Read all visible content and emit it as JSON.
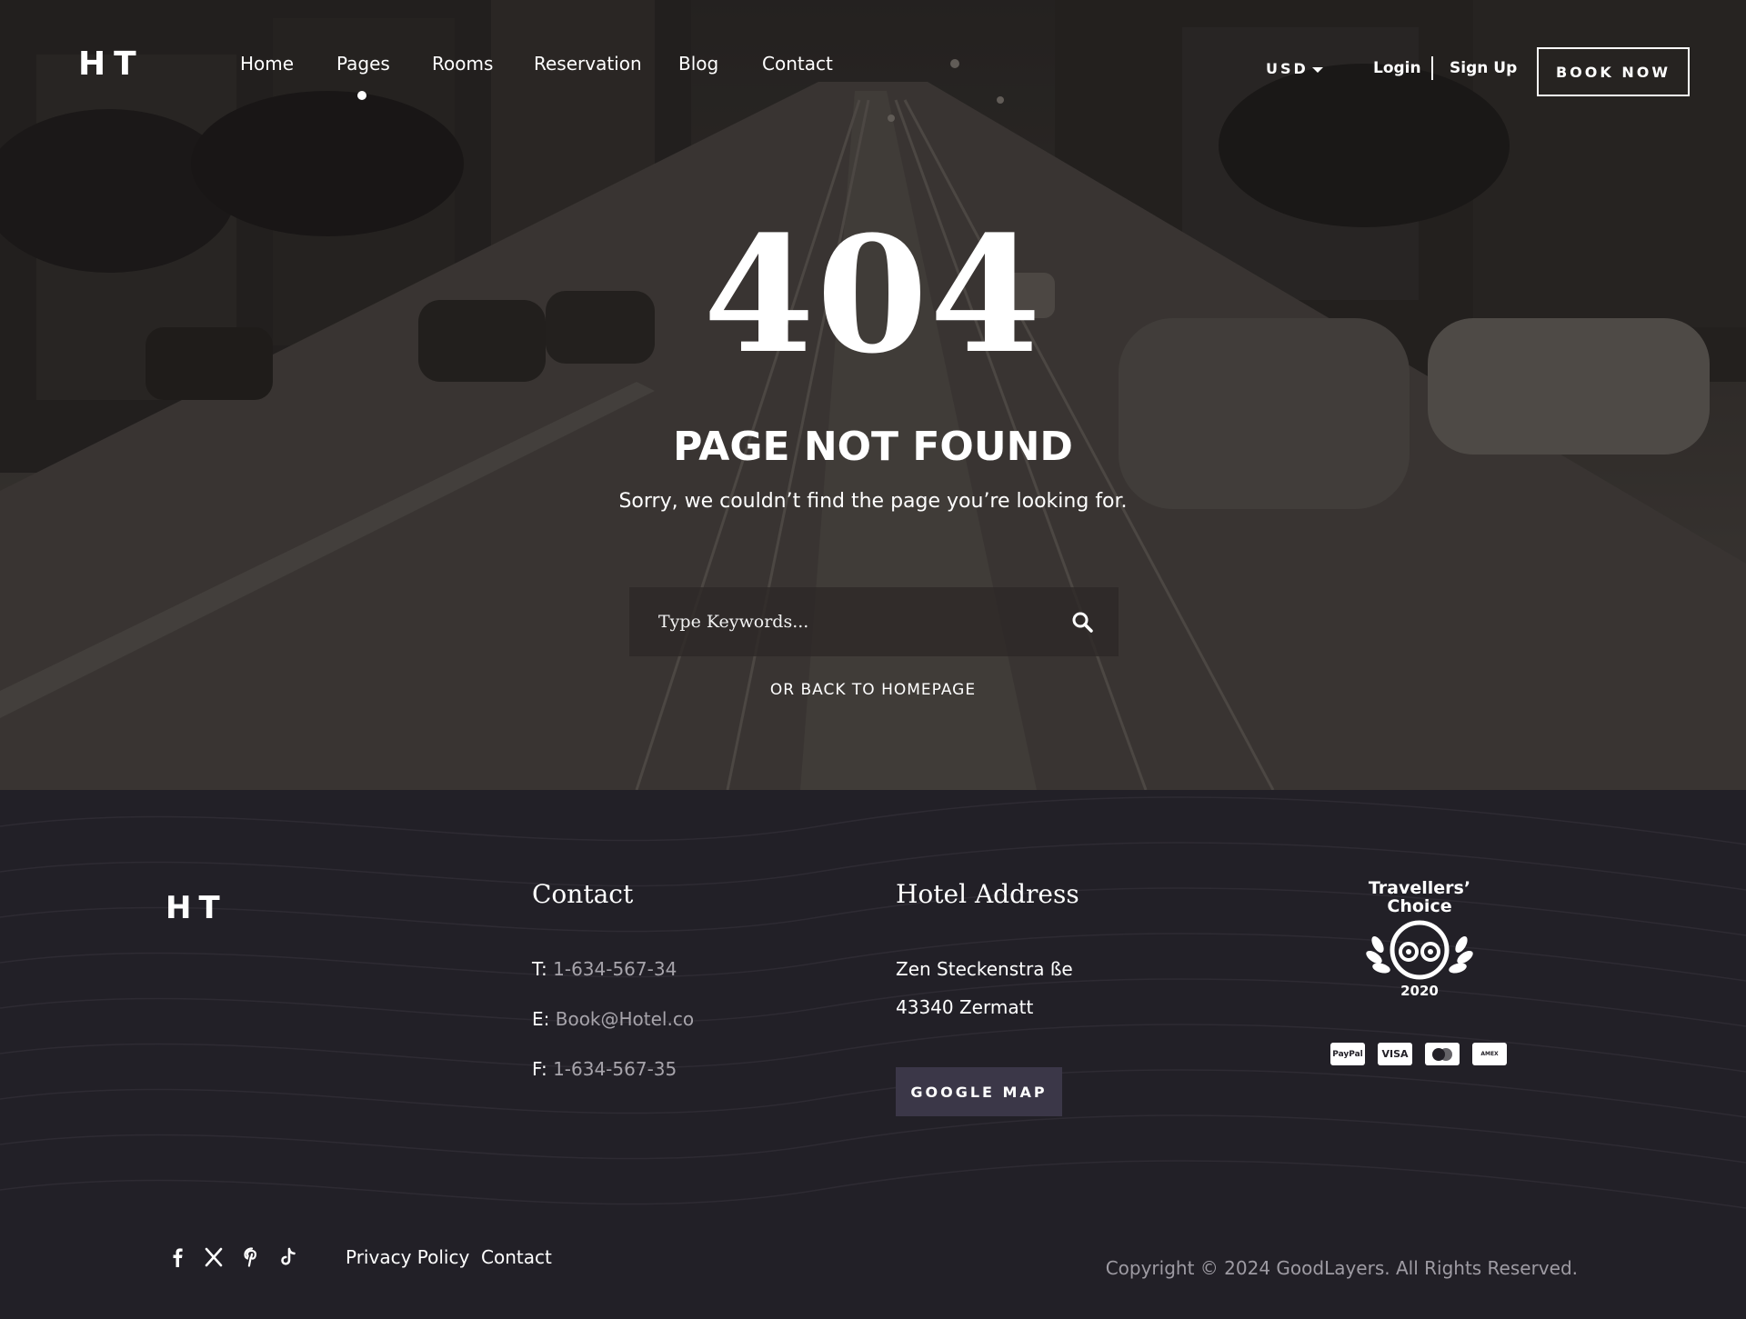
{
  "header": {
    "logo": "HT",
    "nav": [
      "Home",
      "Pages",
      "Rooms",
      "Reservation",
      "Blog",
      "Contact"
    ],
    "active_nav": "Pages",
    "currency": "USD",
    "login": "Login",
    "signup": "Sign Up",
    "book_now": "BOOK NOW"
  },
  "hero": {
    "code": "404",
    "title": "PAGE NOT FOUND",
    "message": "Sorry, we couldn’t find the page you’re looking for.",
    "search_placeholder": "Type Keywords...",
    "back_link": "OR BACK TO HOMEPAGE"
  },
  "footer": {
    "logo": "HT",
    "contact": {
      "title": "Contact",
      "phone_label": "T:",
      "phone": "1-634-567-34",
      "email_label": "E:",
      "email": "Book@Hotel.co",
      "fax_label": "F:",
      "fax": "1-634-567-35"
    },
    "address": {
      "title": "Hotel Address",
      "line1": "Zen Steckenstra ße",
      "line2": "43340 Zermatt",
      "map_button": "GOOGLE MAP"
    },
    "award": {
      "line1": "Travellers’",
      "line2": "Choice",
      "year": "2020"
    },
    "payment_cards": [
      "PayPal",
      "VISA",
      "mastercard",
      "AMERICAN EXPRESS"
    ],
    "social_icons": [
      "facebook-icon",
      "x-icon",
      "pinterest-icon",
      "tiktok-icon"
    ],
    "links": [
      "Privacy Policy",
      "Contact"
    ],
    "copyright": "Copyright © 2024 GoodLayers. All Rights Reserved."
  },
  "colors": {
    "footer_bg": "#222027",
    "button_bg": "#3b3748",
    "muted_text": "#a7a4ab"
  }
}
